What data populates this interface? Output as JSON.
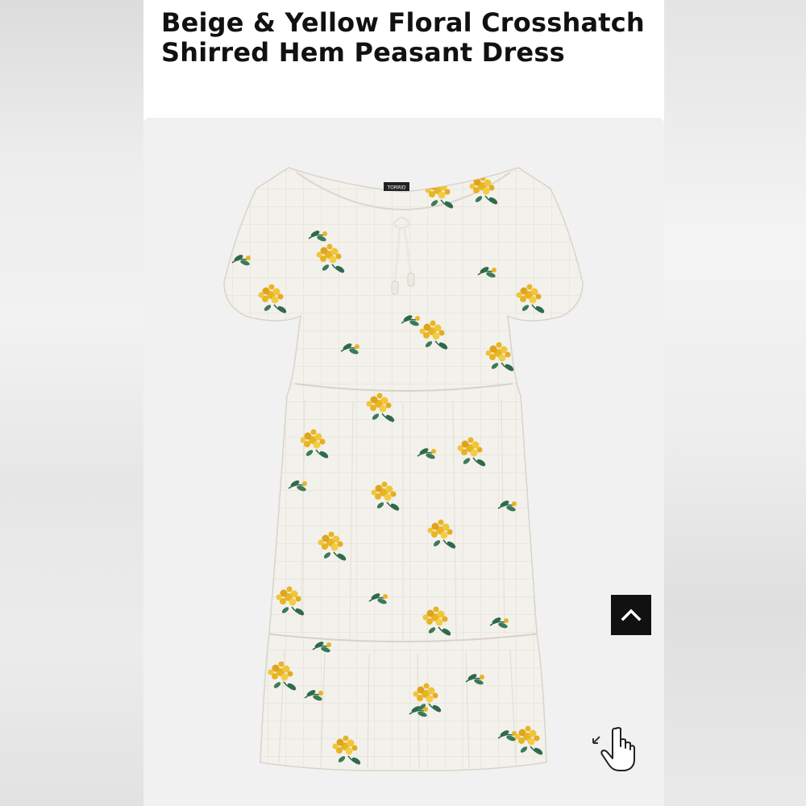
{
  "product": {
    "title": "Beige & Yellow Floral Crosshatch Shirred Hem Peasant Dress",
    "brand_tag": "TORRID"
  },
  "controls": {
    "back_to_top_icon": "chevron-up-icon",
    "zoom_icon": "hand-pointer-zoom-icon"
  },
  "colors": {
    "fabric": "#f2f0ea",
    "flower": "#e8b422",
    "leaf": "#2f6a4a",
    "button_bg": "#111111"
  }
}
